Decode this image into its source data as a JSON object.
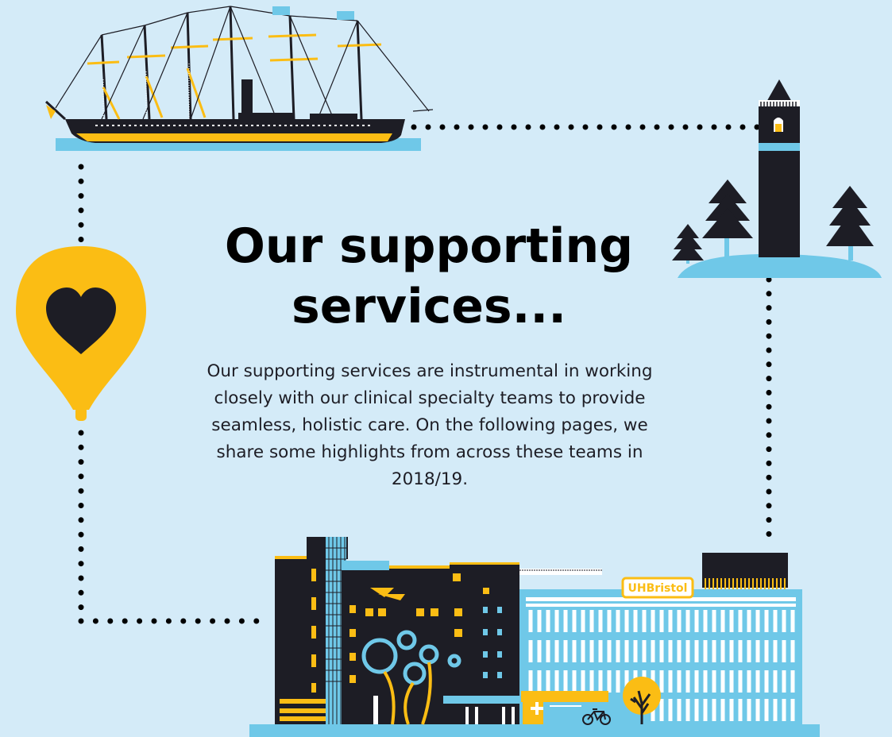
{
  "heading": "Our supporting services...",
  "intro": "Our supporting services are instrumental in working closely with our clinical specialty teams to provide seamless, holistic care. On the following pages, we share some highlights from across these teams in 2018/19.",
  "hospital_sign": "UHBristol",
  "colors": {
    "background": "#d4ebf8",
    "navy": "#1d1d25",
    "yellow": "#fbbd14",
    "sky": "#6fc8e8",
    "white": "#ffffff"
  },
  "icons": [
    "ship-icon",
    "clock-tower-icon",
    "pine-tree-icon",
    "heart-balloon-icon",
    "hospital-building-icon",
    "bicycle-icon",
    "tree-icon"
  ]
}
